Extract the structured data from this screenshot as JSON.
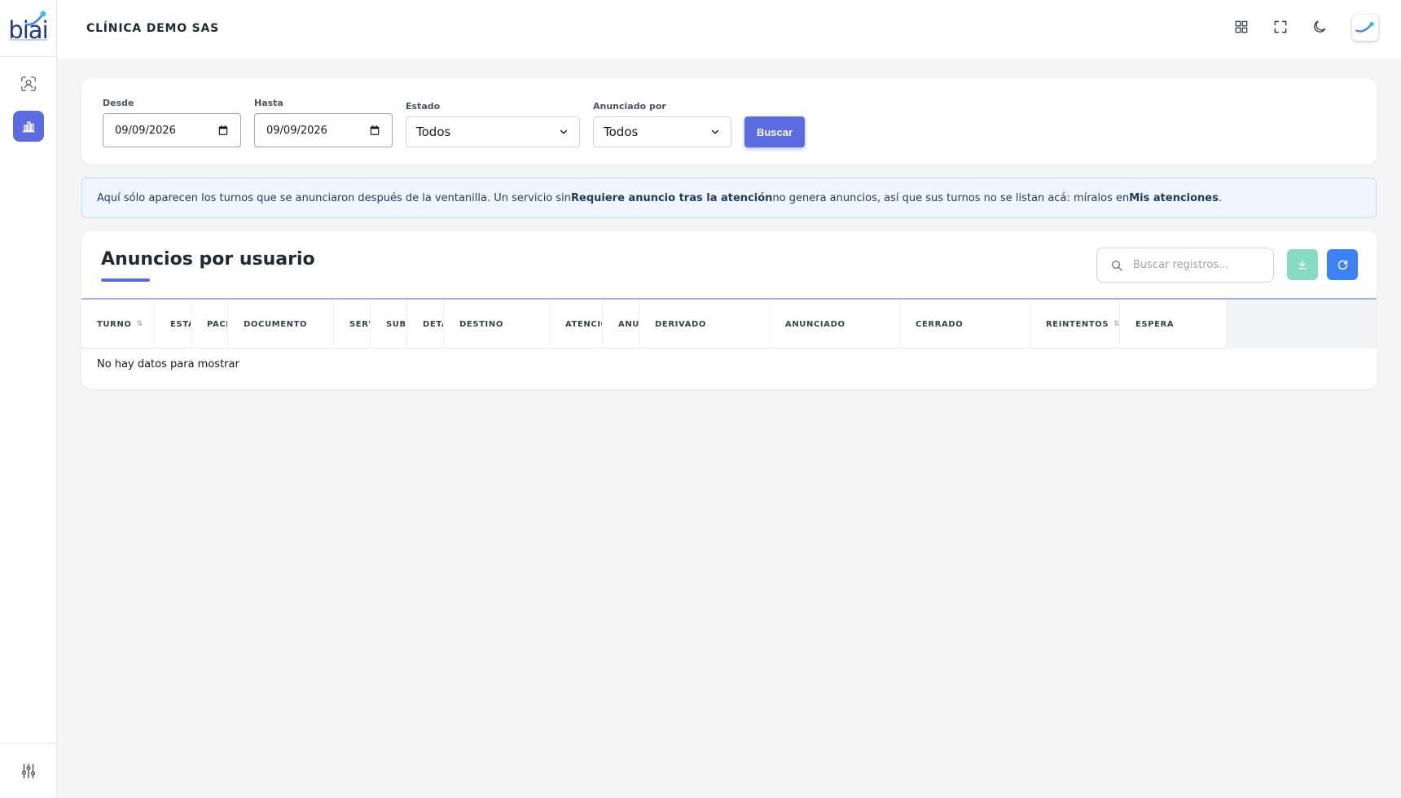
{
  "brand": {
    "logo_text": "biai",
    "accent": "#5b6be0"
  },
  "topbar": {
    "company": "CLÍNICA DEMO SAS",
    "icons": [
      "grid-icon",
      "fullscreen-icon",
      "moon-icon",
      "user-avatar"
    ]
  },
  "sidebar": {
    "items": [
      {
        "icon": "face-scan-icon",
        "active": false
      },
      {
        "icon": "bar-chart-icon",
        "active": true
      }
    ],
    "bottom_icon": "sliders-icon"
  },
  "filters": {
    "desde_label": "Desde",
    "desde_value": "09/09/2026",
    "hasta_label": "Hasta",
    "hasta_value": "09/09/2026",
    "estado_label": "Estado",
    "estado_value": "Todos",
    "anunciado_label": "Anunciado por",
    "anunciado_value": "Todos",
    "buscar_label": "Buscar"
  },
  "alert": {
    "part1": "Aquí sólo aparecen los turnos que se anunciaron después de la ventanilla. Un servicio sin ",
    "bold1": "Requiere anuncio tras la atención",
    "part2": " no genera anuncios, así que sus turnos no se listan acá: míralos en ",
    "bold2": "Mis atenciones",
    "part3": "."
  },
  "table": {
    "title": "Anuncios por usuario",
    "search_placeholder": "Buscar registros...",
    "columns": [
      "TURNO",
      "ESTADO",
      "PACIENTE",
      "DOCUMENTO",
      "SERVICIO",
      "SUBSERVICIO",
      "DETALLE",
      "DESTINO",
      "ATENCIÓN",
      "ANUNCIOS",
      "DERIVADO",
      "ANUNCIADO",
      "CERRADO",
      "REINTENTOS",
      "ESPERA"
    ],
    "empty_text": "No hay datos para mostrar"
  }
}
